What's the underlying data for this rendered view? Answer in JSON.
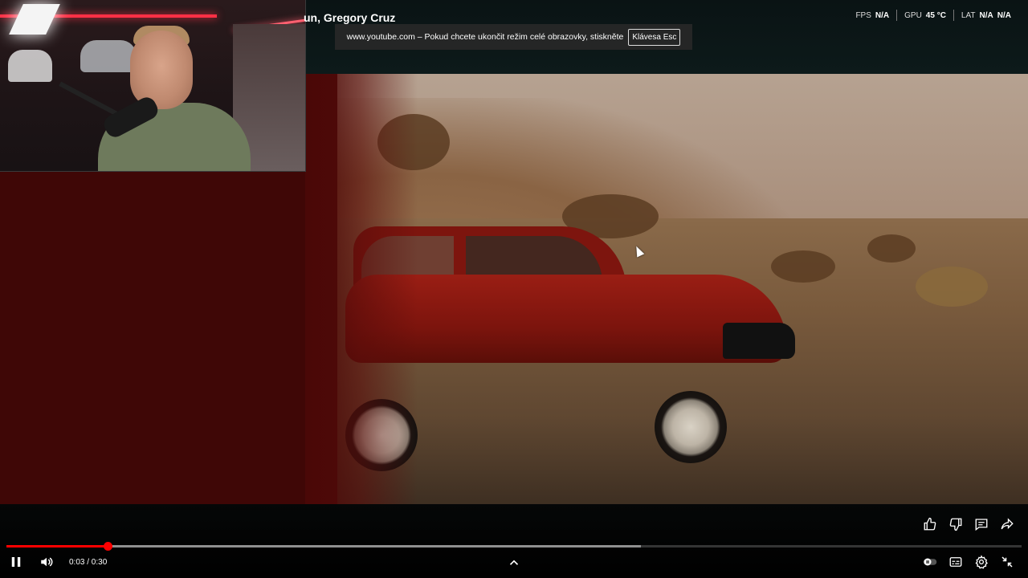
{
  "video": {
    "title": "un, Gregory Cruz"
  },
  "overlay_stats": {
    "fps_label": "FPS",
    "fps_value": "N/A",
    "gpu_label": "GPU",
    "gpu_value": "45 °C",
    "lat_label": "LAT",
    "lat_value": "N/A",
    "lat_value2": "N/A"
  },
  "fullscreen_banner": {
    "message": "www.youtube.com – Pokud chcete ukončit režim celé obrazovky, stiskněte",
    "key_label": "Klávesa Esc"
  },
  "player": {
    "time_display": "0:03 / 0:30",
    "progress_played_fraction": 0.1,
    "progress_buffered_fraction": 0.625,
    "accent_color": "#ff0000"
  },
  "icons": {
    "side_actions": [
      "like-icon",
      "dislike-icon",
      "comment-icon",
      "share-icon"
    ],
    "controls_left": [
      "pause-icon",
      "volume-icon"
    ],
    "controls_right": [
      "autoplay-toggle-icon",
      "subtitles-icon",
      "settings-icon",
      "exit-fullscreen-icon"
    ]
  }
}
